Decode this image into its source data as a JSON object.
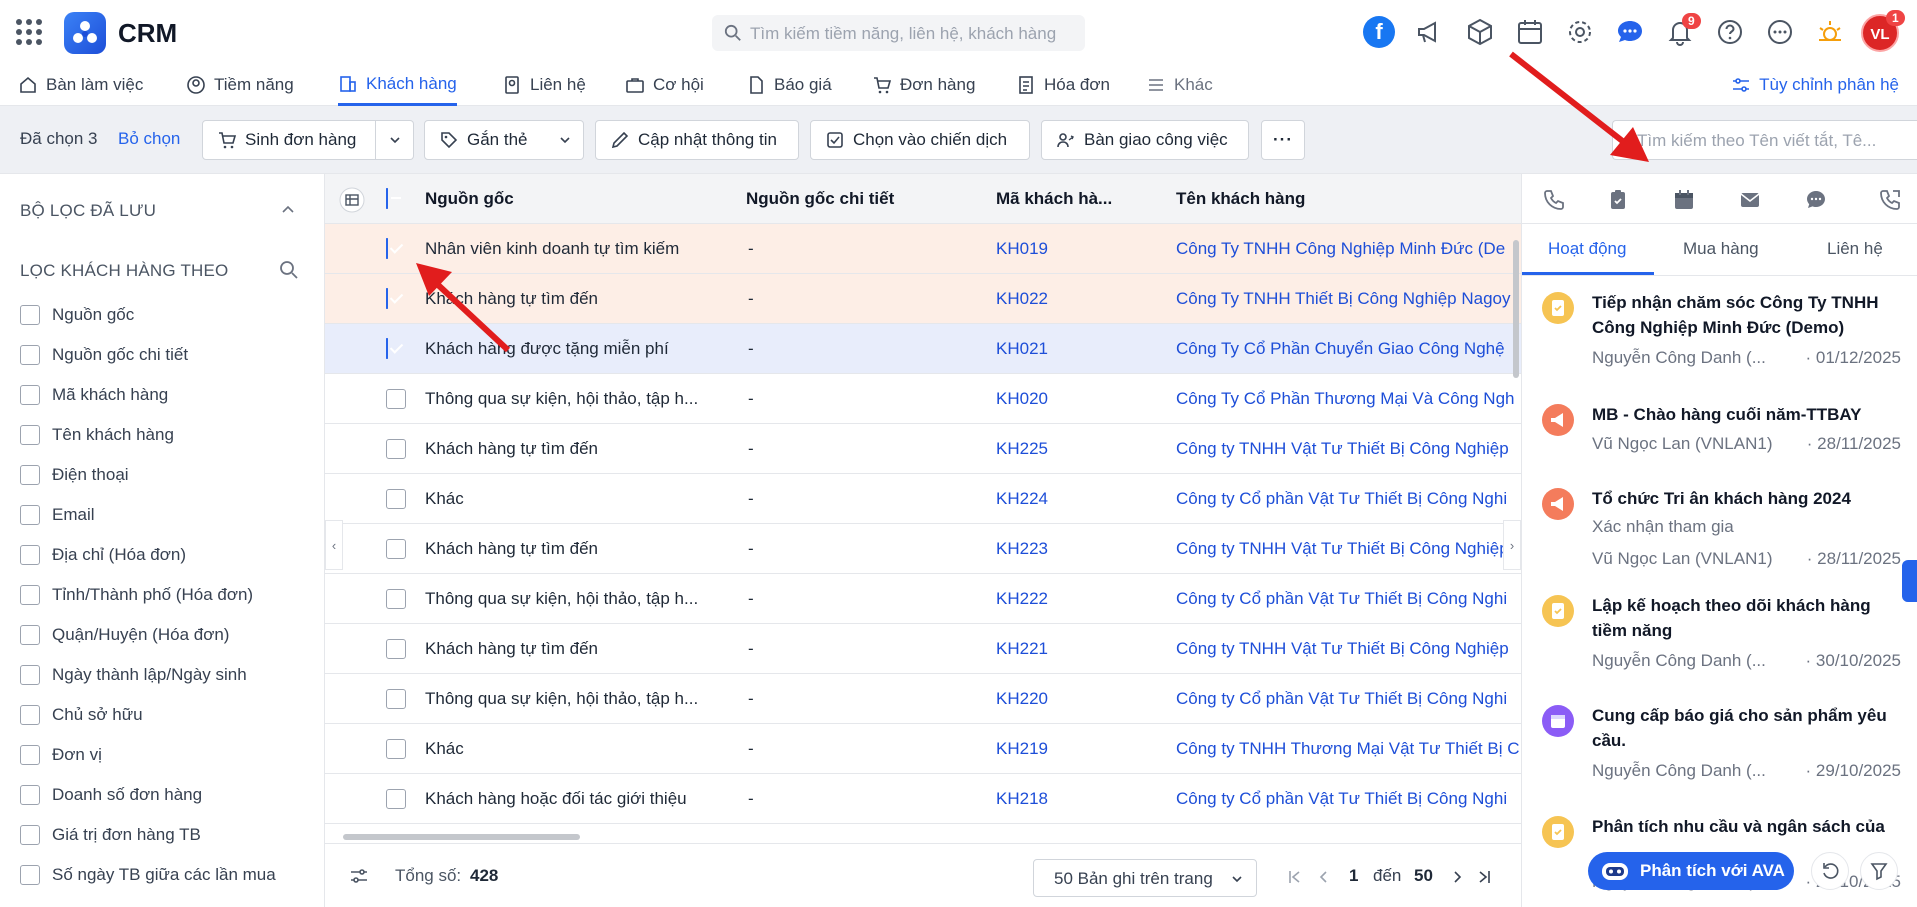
{
  "app": {
    "title": "CRM"
  },
  "search": {
    "placeholder": "Tìm kiếm tiềm năng, liên hệ, khách hàng"
  },
  "header": {
    "notification_count": "9",
    "avatar_initials": "VL",
    "avatar_badge": "1",
    "facebook_letter": "f"
  },
  "nav": {
    "items": [
      {
        "label": "Bàn làm việc",
        "icon": "home-icon"
      },
      {
        "label": "Tiềm năng",
        "icon": "user-circle-icon"
      },
      {
        "label": "Khách hàng",
        "icon": "building-icon",
        "active": true
      },
      {
        "label": "Liên hệ",
        "icon": "contact-icon"
      },
      {
        "label": "Cơ hội",
        "icon": "briefcase-icon"
      },
      {
        "label": "Báo giá",
        "icon": "document-icon"
      },
      {
        "label": "Đơn hàng",
        "icon": "cart-icon"
      },
      {
        "label": "Hóa đơn",
        "icon": "invoice-icon"
      },
      {
        "label": "Khác",
        "icon": "menu-icon"
      }
    ],
    "customize_label": "Tùy chỉnh phân hệ"
  },
  "toolbar": {
    "selected_label": "Đã chọn 3",
    "deselect_label": "Bỏ chọn",
    "create_order_label": "Sinh đơn hàng",
    "tag_label": "Gắn thẻ",
    "update_label": "Cập nhật thông tin",
    "campaign_label": "Chọn vào chiến dịch",
    "handover_label": "Bàn giao công việc",
    "more_label": "···",
    "search_placeholder": "Tìm kiếm theo Tên viết tắt, Tê..."
  },
  "sidebar": {
    "saved_filters_label": "BỘ LỌC ĐÃ LƯU",
    "filter_by_label": "LỌC KHÁCH HÀNG THEO",
    "filters": [
      "Nguồn gốc",
      "Nguồn gốc chi tiết",
      "Mã khách hàng",
      "Tên khách hàng",
      "Điện thoại",
      "Email",
      "Địa chỉ (Hóa đơn)",
      "Tỉnh/Thành phố (Hóa đơn)",
      "Quận/Huyện (Hóa đơn)",
      "Ngày thành lập/Ngày sinh",
      "Chủ sở hữu",
      "Đơn vị",
      "Doanh số đơn hàng",
      "Giá trị đơn hàng TB",
      "Số ngày TB giữa các lần mua"
    ]
  },
  "table": {
    "columns": [
      "Nguồn gốc",
      "Nguồn gốc chi tiết",
      "Mã khách hà...",
      "Tên khách hàng"
    ],
    "rows": [
      {
        "source": "Nhân viên kinh doanh tự tìm kiếm",
        "detail": "-",
        "code": "KH019",
        "name": "Công Ty TNHH Công Nghiệp Minh Đức (De",
        "checked": true,
        "state": "sel"
      },
      {
        "source": "Khách hàng tự tìm đến",
        "detail": "-",
        "code": "KH022",
        "name": "Công Ty TNHH Thiết Bị Công Nghiệp Nagoy",
        "checked": true,
        "state": "sel"
      },
      {
        "source": "Khách hàng được tặng miễn phí",
        "detail": "-",
        "code": "KH021",
        "name": "Công Ty Cổ Phần Chuyển Giao Công Nghệ",
        "checked": true,
        "state": "focus"
      },
      {
        "source": "Thông qua sự kiện, hội thảo, tập h...",
        "detail": "-",
        "code": "KH020",
        "name": "Công Ty Cổ Phần Thương Mại Và Công Ngh",
        "checked": false,
        "state": ""
      },
      {
        "source": "Khách hàng tự tìm đến",
        "detail": "-",
        "code": "KH225",
        "name": "Công ty TNHH Vật Tư Thiết Bị Công Nghiệp",
        "checked": false,
        "state": ""
      },
      {
        "source": "Khác",
        "detail": "-",
        "code": "KH224",
        "name": "Công ty Cổ phần Vật Tư Thiết Bị Công Nghi",
        "checked": false,
        "state": ""
      },
      {
        "source": "Khách hàng tự tìm đến",
        "detail": "-",
        "code": "KH223",
        "name": "Công ty TNHH Vật Tư Thiết Bị Công Nghiệp",
        "checked": false,
        "state": ""
      },
      {
        "source": "Thông qua sự kiện, hội thảo, tập h...",
        "detail": "-",
        "code": "KH222",
        "name": "Công ty Cổ phần Vật Tư Thiết Bị Công Nghi",
        "checked": false,
        "state": ""
      },
      {
        "source": "Khách hàng tự tìm đến",
        "detail": "-",
        "code": "KH221",
        "name": "Công ty TNHH Vật Tư Thiết Bị Công Nghiệp",
        "checked": false,
        "state": ""
      },
      {
        "source": "Thông qua sự kiện, hội thảo, tập h...",
        "detail": "-",
        "code": "KH220",
        "name": "Công ty Cổ phần Vật Tư Thiết Bị Công Nghi",
        "checked": false,
        "state": ""
      },
      {
        "source": "Khác",
        "detail": "-",
        "code": "KH219",
        "name": "Công ty TNHH Thương Mại Vật Tư Thiết Bị C",
        "checked": false,
        "state": ""
      },
      {
        "source": "Khách hàng hoặc đối tác giới thiệu",
        "detail": "-",
        "code": "KH218",
        "name": "Công ty Cổ phần Vật Tư Thiết Bị Công Nghi",
        "checked": false,
        "state": ""
      }
    ]
  },
  "footer": {
    "total_label": "Tổng số:",
    "total_value": "428",
    "page_size_label": "50 Bản ghi trên trang",
    "page_from": "1",
    "page_to_label": "đến",
    "page_to": "50"
  },
  "panel": {
    "tabs": [
      "Hoạt động",
      "Mua hàng",
      "Liên hệ"
    ],
    "activities": [
      {
        "title": "Tiếp nhận chăm sóc Công Ty TNHH Công Nghiệp Minh Đức (Demo)",
        "sub": "",
        "who": "Nguyễn Công Danh (...",
        "date": "01/12/2025",
        "kind": "task",
        "color": "#f6c453"
      },
      {
        "title": "MB - Chào hàng cuối năm-TTBAY",
        "sub": "",
        "who": "Vũ Ngọc Lan (VNLAN1)",
        "date": "28/11/2025",
        "kind": "campaign",
        "color": "#f47c5c"
      },
      {
        "title": "Tổ chức Tri ân khách hàng 2024",
        "sub": "Xác nhận tham gia",
        "who": "Vũ Ngọc Lan (VNLAN1)",
        "date": "28/11/2025",
        "kind": "campaign",
        "color": "#f47c5c"
      },
      {
        "title": "Lập kế hoạch theo dõi khách hàng tiềm năng",
        "sub": "",
        "who": "Nguyễn Công Danh (...",
        "date": "30/10/2025",
        "kind": "task",
        "color": "#f6c453"
      },
      {
        "title": "Cung cấp báo giá cho sản phẩm yêu cầu.",
        "sub": "",
        "who": "Nguyễn Công Danh (...",
        "date": "29/10/2025",
        "kind": "event",
        "color": "#8b5cf6"
      },
      {
        "title": "Phân tích nhu cầu và ngân sách của",
        "sub": "",
        "who": "Nguyễn Công Danh (...",
        "date": "24/10/2025",
        "kind": "task",
        "color": "#f6c453"
      }
    ],
    "ava_label": "Phân tích với AVA"
  },
  "colors": {
    "accent": "#2563eb",
    "selected_row": "#fdeee6",
    "focused_row": "#e8edfb",
    "annotation_arrow": "#e11d1d"
  }
}
